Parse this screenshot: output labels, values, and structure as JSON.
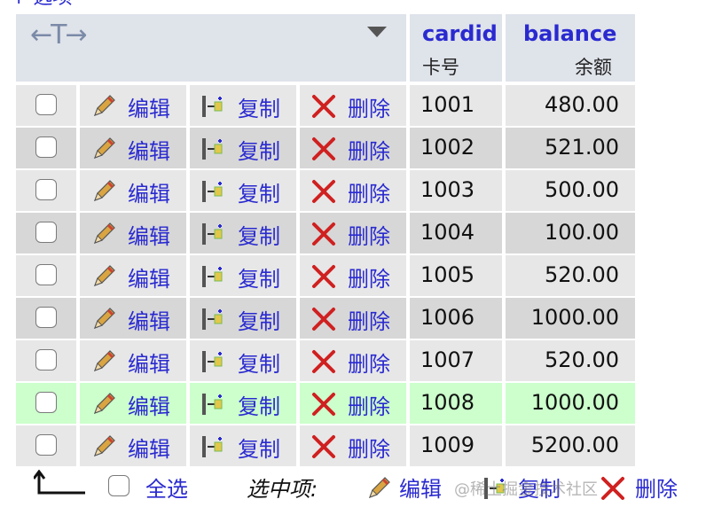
{
  "top_link": "+ 选项",
  "header": {
    "columns": [
      {
        "name": "cardid",
        "comment": "卡号"
      },
      {
        "name": "balance",
        "comment": "余额"
      }
    ]
  },
  "actions": {
    "edit": "编辑",
    "copy": "复制",
    "delete": "删除"
  },
  "rows": [
    {
      "cardid": "1001",
      "balance": "480.00",
      "highlighted": false
    },
    {
      "cardid": "1002",
      "balance": "521.00",
      "highlighted": false
    },
    {
      "cardid": "1003",
      "balance": "500.00",
      "highlighted": false
    },
    {
      "cardid": "1004",
      "balance": "100.00",
      "highlighted": false
    },
    {
      "cardid": "1005",
      "balance": "520.00",
      "highlighted": false
    },
    {
      "cardid": "1006",
      "balance": "1000.00",
      "highlighted": false
    },
    {
      "cardid": "1007",
      "balance": "520.00",
      "highlighted": false
    },
    {
      "cardid": "1008",
      "balance": "1000.00",
      "highlighted": true
    },
    {
      "cardid": "1009",
      "balance": "5200.00",
      "highlighted": false
    }
  ],
  "footer": {
    "select_all": "全选",
    "with_selected": "选中项:",
    "edit": "编辑",
    "copy": "复制",
    "delete": "删除",
    "watermark": "@稀土掘金技术社区"
  },
  "colors": {
    "link": "#2a2ad0",
    "row_odd": "#e7e7e7",
    "row_even": "#d7d7d7",
    "row_highlight": "#ccffcc",
    "header": "#dfe3ea"
  },
  "icons": {
    "edit": "pencil-icon",
    "copy": "copy-icon",
    "delete": "red-x-icon",
    "back": "back-arrow-icon"
  }
}
